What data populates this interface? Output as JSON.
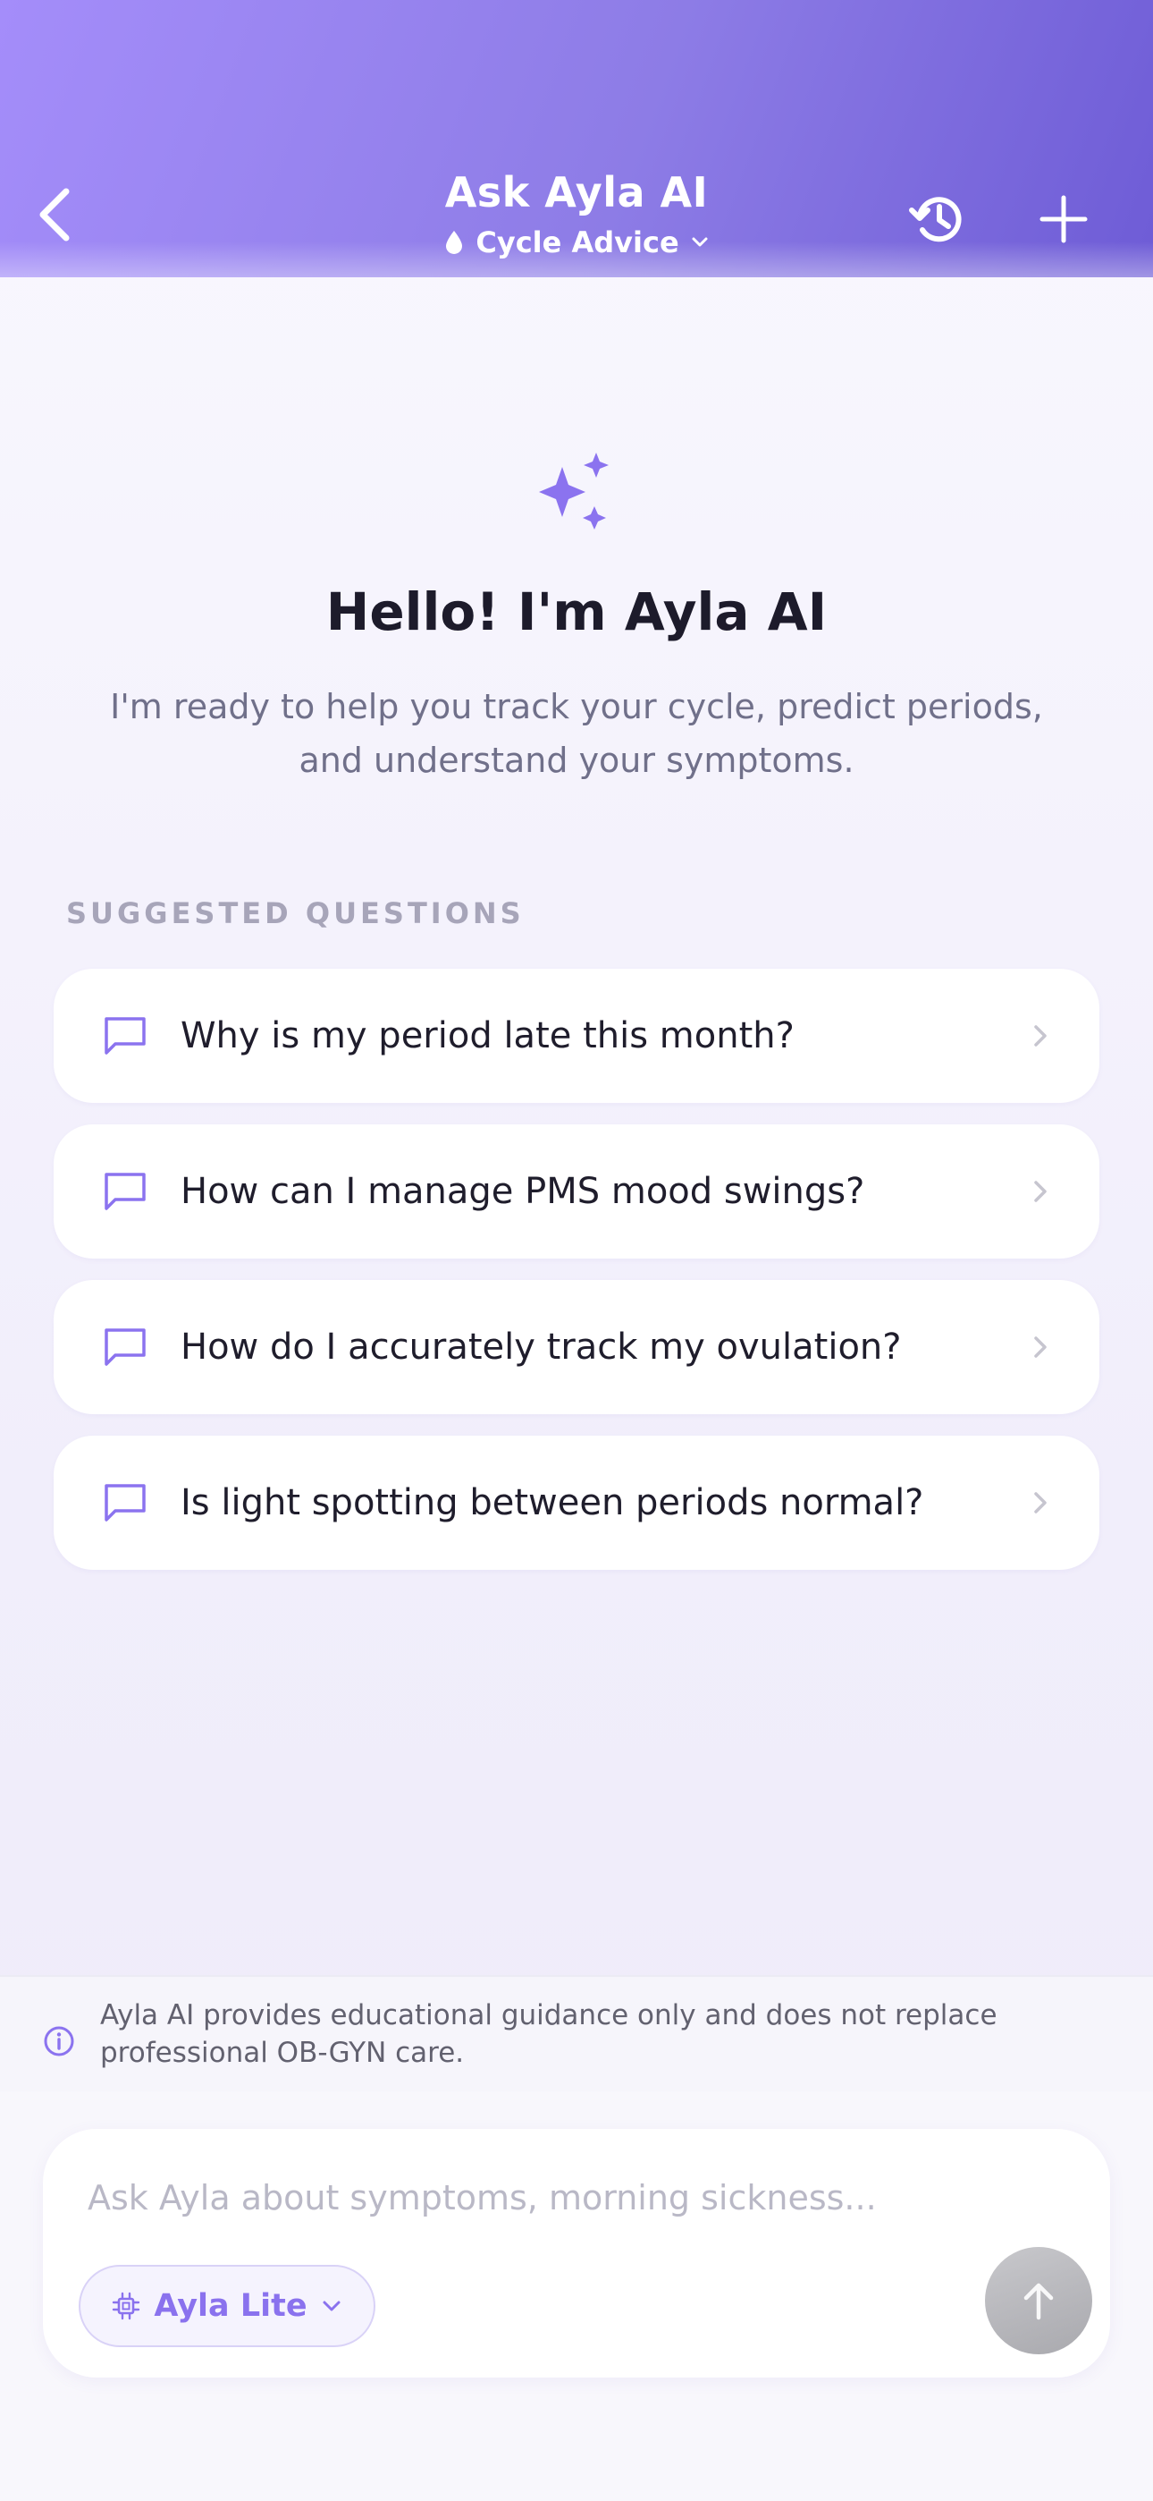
{
  "header": {
    "title": "Ask Ayla AI",
    "mode_label": "Cycle Advice",
    "icons": {
      "back": "chevron-left-icon",
      "history": "history-icon",
      "new": "plus-icon",
      "mode": "drop-icon",
      "mode_dropdown": "chevron-down-icon"
    },
    "colors": {
      "gradient_start": "#a48dfa",
      "gradient_end": "#6e5cd6"
    }
  },
  "intro": {
    "icon": "sparkles-icon",
    "heading": "Hello! I'm Ayla AI",
    "body": "I'm ready to help you track your cycle, predict periods, and understand your symptoms."
  },
  "suggestions": {
    "label": "SUGGESTED QUESTIONS",
    "items": [
      {
        "text": "Why is my period late this month?"
      },
      {
        "text": "How can I manage PMS mood swings?"
      },
      {
        "text": "How do I accurately track my ovulation?"
      },
      {
        "text": "Is light spotting between periods normal?"
      }
    ]
  },
  "disclaimer": {
    "icon": "info-icon",
    "text": "Ayla AI provides educational guidance only and does not replace professional OB-GYN care."
  },
  "composer": {
    "placeholder": "Ask Ayla about symptoms, morning sickness...",
    "value": "",
    "model_label": "Ayla Lite",
    "icons": {
      "model": "chip-icon",
      "model_dropdown": "chevron-down-icon",
      "send": "arrow-up-icon"
    }
  },
  "colors": {
    "accent": "#8a72ee",
    "send_disabled": "#b4b4b8"
  }
}
